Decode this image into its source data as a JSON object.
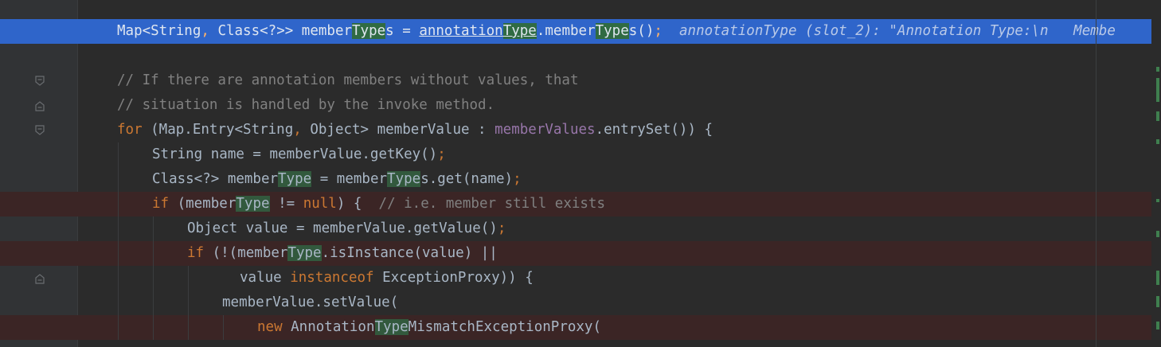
{
  "editor": {
    "lines": [
      {
        "id": "line-1",
        "state": "execution-point",
        "gutter_icon": "breakpoint-icon",
        "indent": 0,
        "tokens": [
          {
            "t": "Map<String",
            "k": "plain"
          },
          {
            "t": ", ",
            "k": "kw"
          },
          {
            "t": "Class<?>> member",
            "k": "plain"
          },
          {
            "t": "Type",
            "k": "hl"
          },
          {
            "t": "s = ",
            "k": "plain"
          },
          {
            "t": "annotation",
            "k": "u"
          },
          {
            "t": "Type",
            "k": "hl-u"
          },
          {
            "t": ".member",
            "k": "plain"
          },
          {
            "t": "Type",
            "k": "hl"
          },
          {
            "t": "s()",
            "k": "plain"
          },
          {
            "t": ";",
            "k": "kw"
          },
          {
            "t": "  annotationType (slot_2): \"Annotation Type:\\n   Membe",
            "k": "hint"
          }
        ]
      },
      {
        "id": "line-2",
        "state": "normal",
        "gutter_icon": "",
        "indent": 0,
        "tokens": []
      },
      {
        "id": "line-3",
        "state": "normal",
        "gutter_icon": "fold-icon",
        "indent": 0,
        "tokens": [
          {
            "t": "// If there are annotation members without values, that",
            "k": "cm"
          }
        ]
      },
      {
        "id": "line-4",
        "state": "normal",
        "gutter_icon": "fold-end-icon",
        "indent": 0,
        "tokens": [
          {
            "t": "// situation is handled by the invoke method.",
            "k": "cm"
          }
        ]
      },
      {
        "id": "line-5",
        "state": "normal",
        "gutter_icon": "fold-icon",
        "indent": 0,
        "tokens": [
          {
            "t": "for",
            "k": "kw"
          },
          {
            "t": " (Map.Entry<String",
            "k": "plain"
          },
          {
            "t": ", ",
            "k": "kw"
          },
          {
            "t": "Object> memberValue : ",
            "k": "plain"
          },
          {
            "t": "memberValues",
            "k": "fld"
          },
          {
            "t": ".entrySet()) {",
            "k": "plain"
          }
        ]
      },
      {
        "id": "line-6",
        "state": "normal",
        "gutter_icon": "",
        "indent": 1,
        "tokens": [
          {
            "t": "String name = memberValue.getKey()",
            "k": "plain"
          },
          {
            "t": ";",
            "k": "kw"
          }
        ]
      },
      {
        "id": "line-7",
        "state": "normal",
        "gutter_icon": "",
        "indent": 1,
        "tokens": [
          {
            "t": "Class<?> member",
            "k": "plain"
          },
          {
            "t": "Type",
            "k": "hl"
          },
          {
            "t": " = member",
            "k": "plain"
          },
          {
            "t": "Type",
            "k": "hl"
          },
          {
            "t": "s.get(name)",
            "k": "plain"
          },
          {
            "t": ";",
            "k": "kw"
          }
        ]
      },
      {
        "id": "line-8",
        "state": "breakpoint",
        "gutter_icon": "breakpoint-icon",
        "fold": "fold-icon",
        "indent": 1,
        "tokens": [
          {
            "t": "if",
            "k": "kw"
          },
          {
            "t": " (member",
            "k": "plain"
          },
          {
            "t": "Type",
            "k": "hl"
          },
          {
            "t": " != ",
            "k": "plain"
          },
          {
            "t": "null",
            "k": "kw"
          },
          {
            "t": ") {  ",
            "k": "plain"
          },
          {
            "t": "// i.e. member still exists",
            "k": "cm"
          }
        ]
      },
      {
        "id": "line-9",
        "state": "normal",
        "gutter_icon": "",
        "indent": 2,
        "tokens": [
          {
            "t": "Object value = memberValue.getValue()",
            "k": "plain"
          },
          {
            "t": ";",
            "k": "kw"
          }
        ]
      },
      {
        "id": "line-10",
        "state": "breakpoint",
        "gutter_icon": "breakpoint-icon",
        "indent": 2,
        "tokens": [
          {
            "t": "if",
            "k": "kw"
          },
          {
            "t": " (!(member",
            "k": "plain"
          },
          {
            "t": "Type",
            "k": "hl"
          },
          {
            "t": ".isInstance(value) ||",
            "k": "plain"
          }
        ]
      },
      {
        "id": "line-11",
        "state": "normal",
        "gutter_icon": "fold-end-icon",
        "indent": 3.5,
        "tokens": [
          {
            "t": "value ",
            "k": "plain"
          },
          {
            "t": "instanceof",
            "k": "kw"
          },
          {
            "t": " ExceptionProxy)) {",
            "k": "plain"
          }
        ]
      },
      {
        "id": "line-12",
        "state": "normal",
        "gutter_icon": "",
        "indent": 3,
        "tokens": [
          {
            "t": "memberValue.setValue(",
            "k": "plain"
          }
        ]
      },
      {
        "id": "line-13",
        "state": "breakpoint",
        "gutter_icon": "muted-breakpoint-icon",
        "indent": 4,
        "tokens": [
          {
            "t": "new",
            "k": "kw"
          },
          {
            "t": " Annotation",
            "k": "plain"
          },
          {
            "t": "Type",
            "k": "hl"
          },
          {
            "t": "MismatchExceptionProxy(",
            "k": "plain"
          }
        ]
      }
    ]
  },
  "colors": {
    "background": "#2b2b2b",
    "execution_line": "#2f65ca",
    "breakpoint_line": "#3b2525",
    "breakpoint": "#c75450",
    "identifier_highlight": "#32593d",
    "keyword": "#cc7832",
    "comment": "#808080",
    "field": "#9876aa"
  }
}
